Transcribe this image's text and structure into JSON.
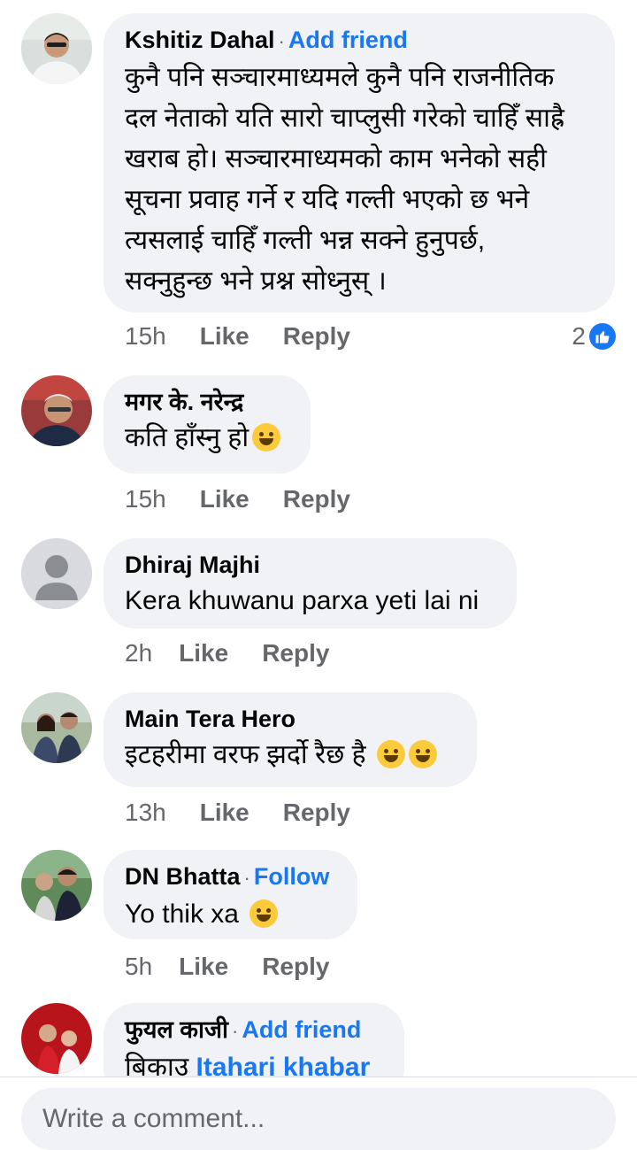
{
  "comments": [
    {
      "author": "Kshitiz Dahal",
      "action": "Add friend",
      "lines": [
        "कुनै पनि सञ्चारमाध्यमले कुनै पनि राजनीतिक",
        "दल नेताको यति सारो चाप्लुसी गरेको चाहिँ साह्रै",
        "खराब हो। सञ्चारमाध्यमको काम भनेको सही",
        "सूचना प्रवाह गर्ने र यदि गल्ती भएको छ भने",
        "त्यसलाई चाहिँ गल्ती भन्न सक्ने हुनुपर्छ,",
        "सक्नुहुन्छ भने प्रश्न सोध्नुस् ।"
      ],
      "time": "15h",
      "like": "Like",
      "reply": "Reply",
      "reaction_count": "2",
      "reaction_icon": "like-icon"
    },
    {
      "author": "मगर के. नरेन्द्र",
      "text": "कति हाँस्नु हो",
      "emoji": "laughing-tears-emoji",
      "time": "15h",
      "like": "Like",
      "reply": "Reply"
    },
    {
      "author": "Dhiraj Majhi",
      "text": "Kera khuwanu parxa yeti lai ni",
      "time": "2h",
      "like": "Like",
      "reply": "Reply"
    },
    {
      "author": "Main Tera Hero",
      "text": "इटहरीमा वरफ झर्दो रैछ है",
      "emoji": "grinning-emoji",
      "time": "13h",
      "like": "Like",
      "reply": "Reply"
    },
    {
      "author": "DN Bhatta",
      "action": "Follow",
      "text": "Yo thik xa",
      "emoji": "smiley-emoji",
      "time": "5h",
      "like": "Like",
      "reply": "Reply"
    },
    {
      "author": "फुयल काजी",
      "action": "Add friend",
      "text_prefix": "बिकाउ",
      "text_link": "Itahari khabar"
    }
  ],
  "composer": {
    "placeholder": "Write a comment..."
  },
  "colors": {
    "accent": "#1877f2",
    "bubble": "#f0f2f5",
    "meta": "#65676b"
  }
}
